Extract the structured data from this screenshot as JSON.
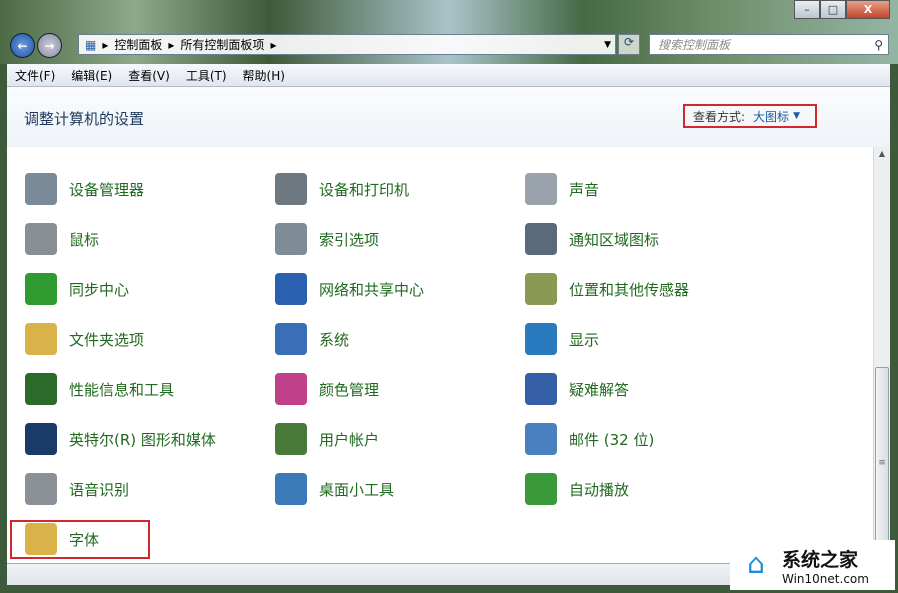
{
  "window": {
    "minimize": "–",
    "maximize": "□",
    "close": "X"
  },
  "address": {
    "breadcrumb": [
      "控制面板",
      "所有控制面板项"
    ],
    "search_placeholder": "搜索控制面板"
  },
  "menu": [
    "文件(F)",
    "编辑(E)",
    "查看(V)",
    "工具(T)",
    "帮助(H)"
  ],
  "header": {
    "title": "调整计算机的设置",
    "view_label": "查看方式:",
    "view_value": "大图标"
  },
  "items": [
    {
      "label": "设备管理器",
      "icon": "device-manager-icon",
      "color": "#7a8a99"
    },
    {
      "label": "设备和打印机",
      "icon": "printer-icon",
      "color": "#6d7880"
    },
    {
      "label": "声音",
      "icon": "speaker-icon",
      "color": "#9aa3ab"
    },
    {
      "label": "鼠标",
      "icon": "mouse-icon",
      "color": "#8a8f94"
    },
    {
      "label": "索引选项",
      "icon": "magnifier-icon",
      "color": "#7f8b96"
    },
    {
      "label": "通知区域图标",
      "icon": "taskbar-icon",
      "color": "#5a6a7a"
    },
    {
      "label": "同步中心",
      "icon": "sync-icon",
      "color": "#2f9a2f"
    },
    {
      "label": "网络和共享中心",
      "icon": "network-icon",
      "color": "#2b5fb0"
    },
    {
      "label": "位置和其他传感器",
      "icon": "sensor-icon",
      "color": "#8a9a55"
    },
    {
      "label": "文件夹选项",
      "icon": "folder-icon",
      "color": "#d9b24a"
    },
    {
      "label": "系统",
      "icon": "computer-icon",
      "color": "#3a6fb8"
    },
    {
      "label": "显示",
      "icon": "monitor-icon",
      "color": "#2a7ac0"
    },
    {
      "label": "性能信息和工具",
      "icon": "performance-icon",
      "color": "#2a6a2a"
    },
    {
      "label": "颜色管理",
      "icon": "color-management-icon",
      "color": "#c0408a"
    },
    {
      "label": "疑难解答",
      "icon": "troubleshoot-icon",
      "color": "#3560a8"
    },
    {
      "label": "英特尔(R) 图形和媒体",
      "icon": "intel-graphics-icon",
      "color": "#1a3a6a"
    },
    {
      "label": "用户帐户",
      "icon": "users-icon",
      "color": "#4a7a3a"
    },
    {
      "label": "邮件 (32 位)",
      "icon": "mail-icon",
      "color": "#4a80c0"
    },
    {
      "label": "语音识别",
      "icon": "microphone-icon",
      "color": "#8a9096"
    },
    {
      "label": "桌面小工具",
      "icon": "gadgets-icon",
      "color": "#3a7ab8"
    },
    {
      "label": "自动播放",
      "icon": "autoplay-icon",
      "color": "#3a9a3a"
    },
    {
      "label": "字体",
      "icon": "fonts-icon",
      "color": "#d9b24a"
    }
  ],
  "watermark": {
    "name": "系统之家",
    "url": "Win10net.com"
  }
}
